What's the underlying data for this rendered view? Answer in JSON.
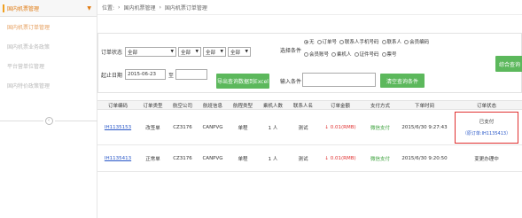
{
  "sidebar": {
    "header": "国内机票管理",
    "items": [
      "国内机票订单管理",
      "国内机票业务政策",
      "平台营单位管理",
      "国内特价政策管理"
    ]
  },
  "breadcrumb": [
    "位置:",
    "›",
    "国内机票管理",
    "›",
    "国内机票订单管理"
  ],
  "filter": {
    "order_status_label": "订单状态",
    "selects": [
      "全部",
      "全部",
      "全部",
      "全部"
    ],
    "date_label": "起止日期",
    "date_from": "2015-06-23",
    "date_to_label": "至",
    "date_to": "",
    "export_button": "导出查询数据到Excel",
    "cond_label": "选择条件",
    "radios": [
      "无",
      "订单号",
      "联系人手机号码",
      "联系人",
      "会员编码",
      "会员账号",
      "乘机人",
      "证件号码",
      "票号"
    ],
    "input_label": "输入条件",
    "clear_button": "清空查询条件",
    "search_button": "综合查询"
  },
  "table": {
    "headers": [
      "订单编码",
      "订单类型",
      "航空公司",
      "航班信息",
      "航程类型",
      "乘机人数",
      "联系人名",
      "订单金额",
      "支付方式",
      "下单时间",
      "订单状态"
    ],
    "rows": [
      {
        "code": "IH1135153",
        "type": "改签单",
        "airline": "CZ3176",
        "flight": "CANPVG",
        "trip": "单程",
        "pax": "1 人",
        "contact": "测试",
        "amount": "0.01(RMB)",
        "pay": "微信支付",
        "time": "2015/6/30 9:27:43",
        "status": "已支付",
        "status_sub": "（原订单:IH1135413）"
      },
      {
        "code": "IH1135413",
        "type": "正常单",
        "airline": "CZ3176",
        "flight": "CANPVG",
        "trip": "单程",
        "pax": "1 人",
        "contact": "测试",
        "amount": "0.01(RMB)",
        "pay": "微信支付",
        "time": "2015/6/30 9:20:50",
        "status": "变更办理中"
      }
    ]
  },
  "colors": {
    "accent": "#e07a10",
    "button_green": "#5cb85c",
    "link_blue": "#2a58c8",
    "amount_red": "#e03030"
  }
}
